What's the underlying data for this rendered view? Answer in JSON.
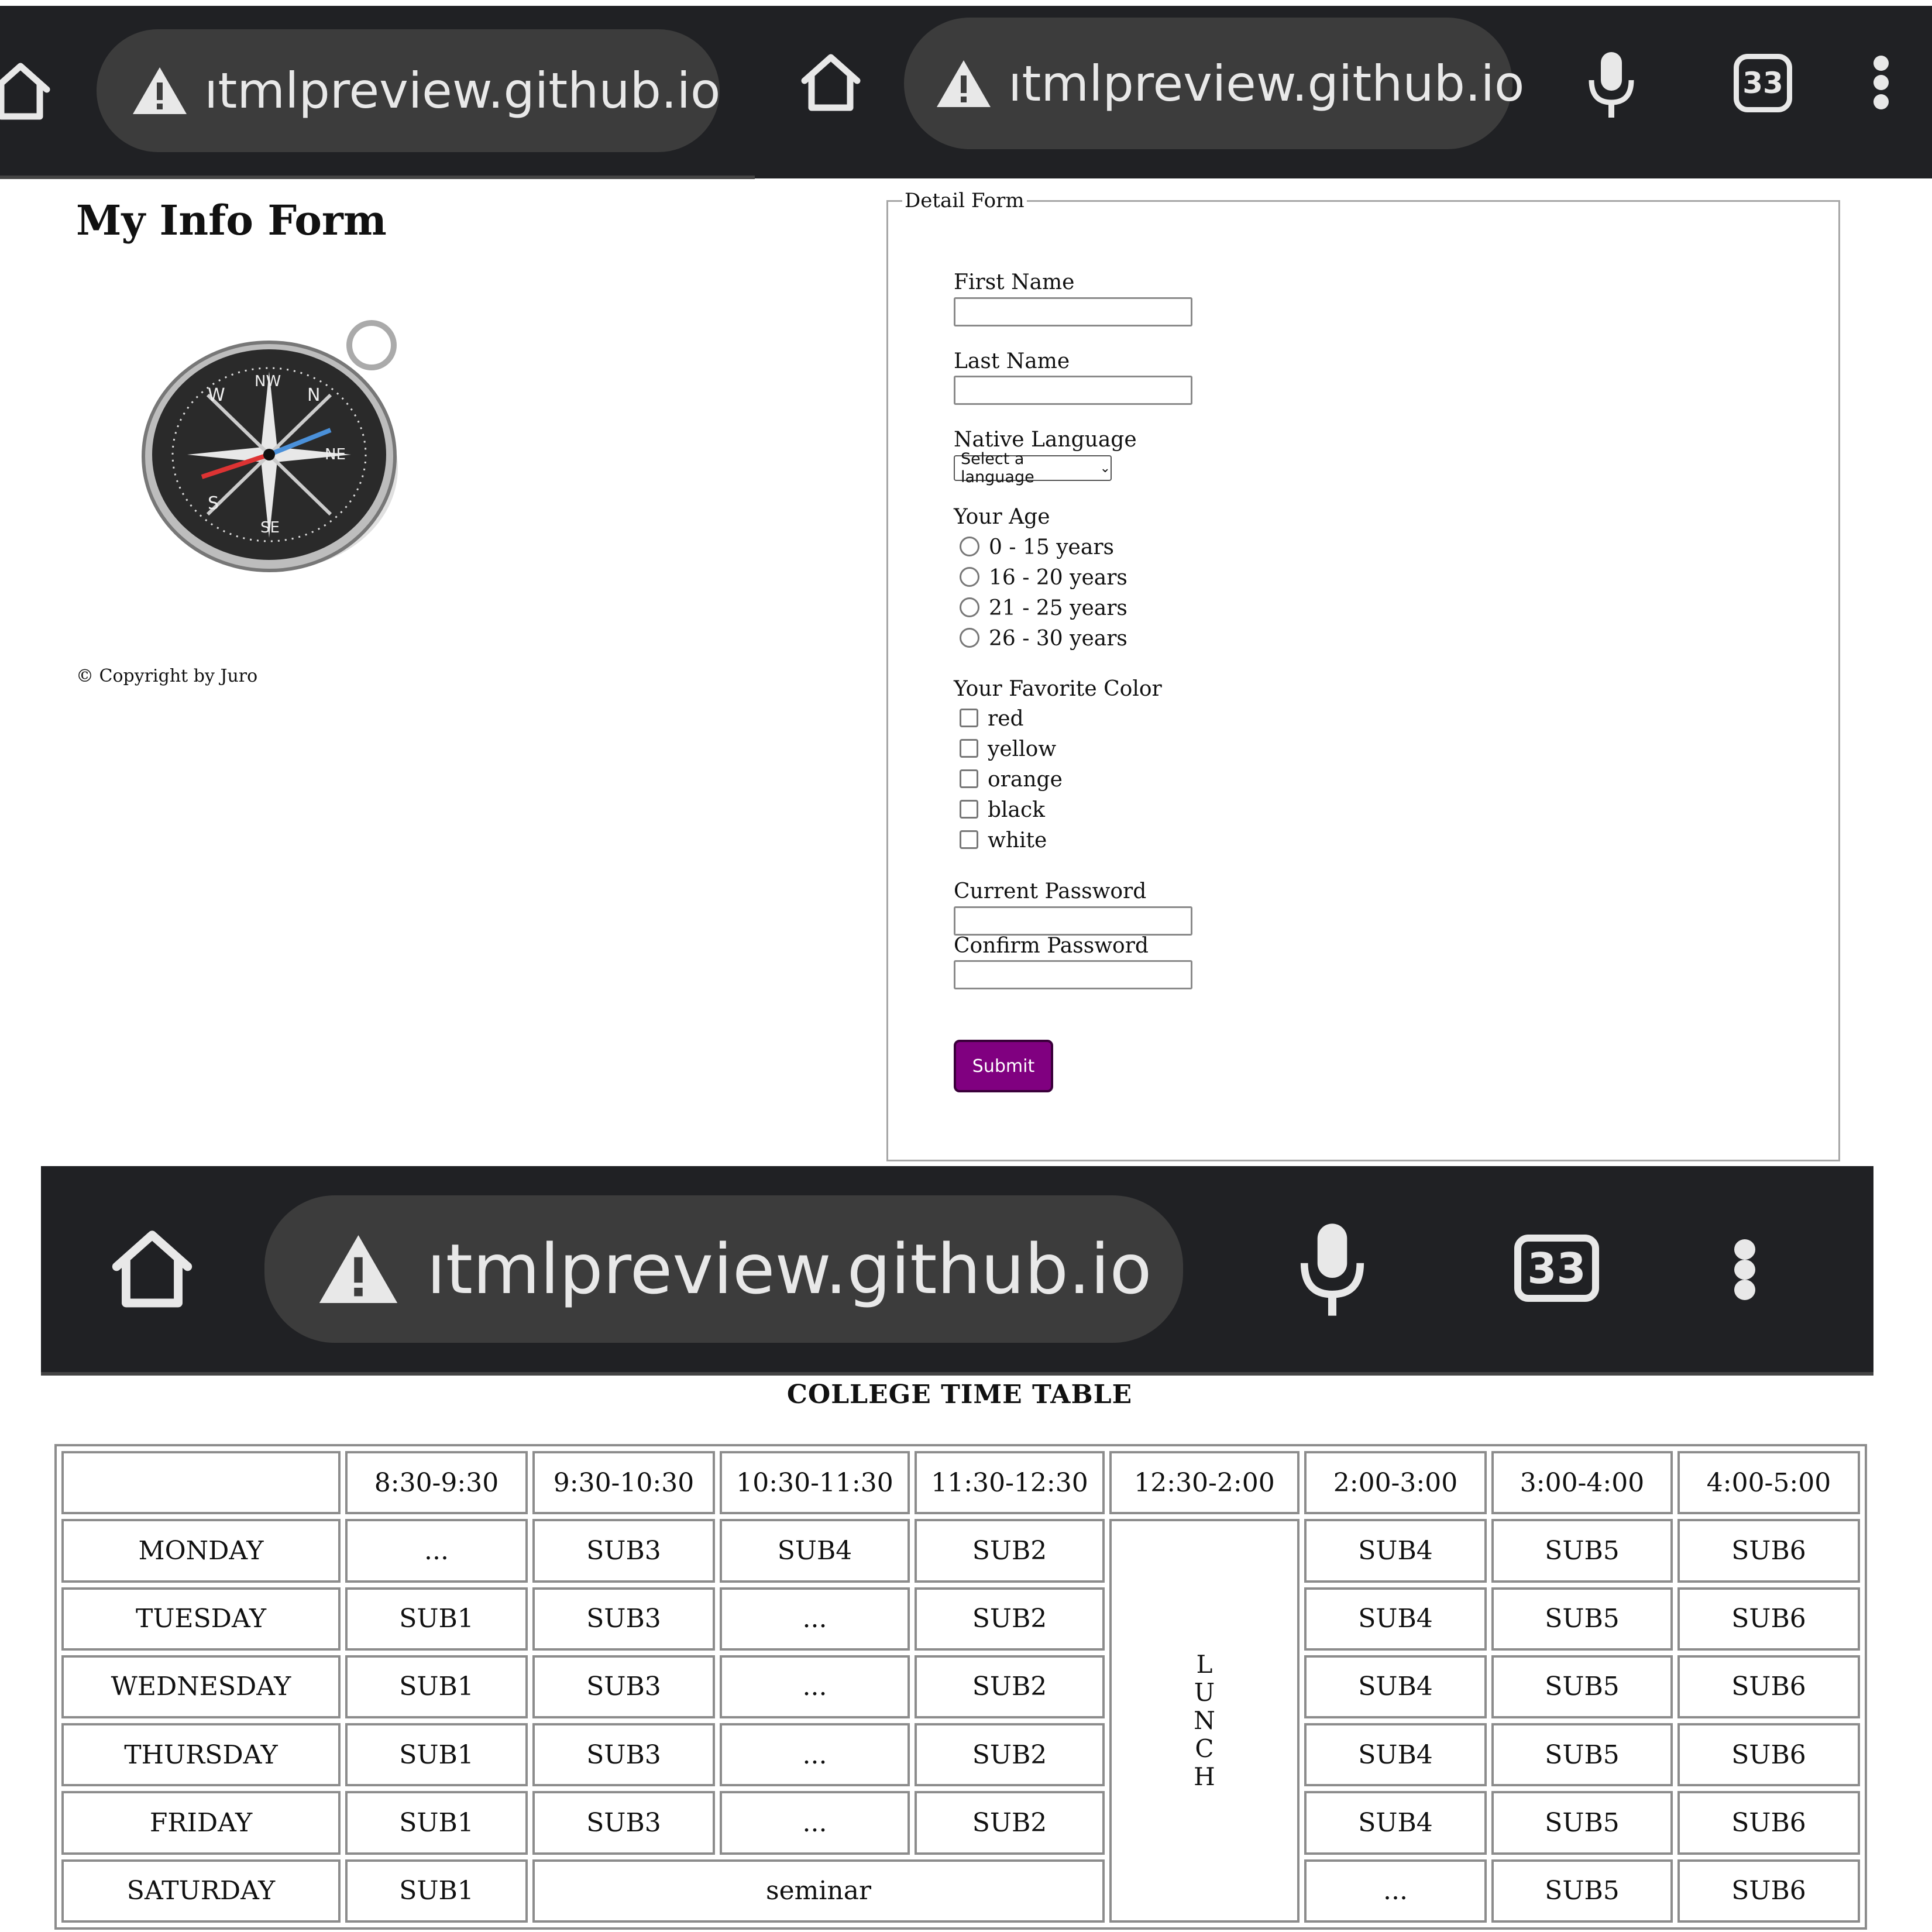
{
  "browser_bar": {
    "url": "ıtmlpreview.github.io",
    "tab_count": "33",
    "home_icon": "home-icon",
    "warning_icon": "warning-icon",
    "mic_icon": "mic-icon",
    "menu_icon": "more-vert-icon",
    "bar_color": "#202124"
  },
  "form_page": {
    "title": "My Info Form",
    "image_icon": "compass-image",
    "copyright": "© Copyright by Juro",
    "legend": "Detail Form",
    "first_name_label": "First Name",
    "last_name_label": "Last Name",
    "native_language_label": "Native Language",
    "language_select_value": "Select a language",
    "age_label": "Your Age",
    "age_options": [
      "0 - 15 years",
      "16 - 20 years",
      "21 - 25 years",
      "26 - 30 years"
    ],
    "color_label": "Your Favorite Color",
    "color_options": [
      "red",
      "yellow",
      "orange",
      "black",
      "white"
    ],
    "current_password_label": "Current Password",
    "confirm_password_label": "Confirm Password",
    "submit_label": "Submit",
    "submit_color": "#800080"
  },
  "timetable": {
    "title": "COLLEGE TIME TABLE",
    "corner": "",
    "time_slots": [
      "8:30-9:30",
      "9:30-10:30",
      "10:30-11:30",
      "11:30-12:30",
      "12:30-2:00",
      "2:00-3:00",
      "3:00-4:00",
      "4:00-5:00"
    ],
    "lunch_letters": [
      "L",
      "U",
      "N",
      "C",
      "H"
    ],
    "rows": [
      {
        "day": "MONDAY",
        "cells": [
          "...",
          "SUB3",
          "SUB4",
          "SUB2",
          "SUB4",
          "SUB5",
          "SUB6"
        ]
      },
      {
        "day": "TUESDAY",
        "cells": [
          "SUB1",
          "SUB3",
          "...",
          "SUB2",
          "SUB4",
          "SUB5",
          "SUB6"
        ]
      },
      {
        "day": "WEDNESDAY",
        "cells": [
          "SUB1",
          "SUB3",
          "...",
          "SUB2",
          "SUB4",
          "SUB5",
          "SUB6"
        ]
      },
      {
        "day": "THURSDAY",
        "cells": [
          "SUB1",
          "SUB3",
          "...",
          "SUB2",
          "SUB4",
          "SUB5",
          "SUB6"
        ]
      },
      {
        "day": "FRIDAY",
        "cells": [
          "SUB1",
          "SUB3",
          "...",
          "SUB2",
          "SUB4",
          "SUB5",
          "SUB6"
        ]
      }
    ],
    "saturday": {
      "day": "SATURDAY",
      "first": "SUB1",
      "seminar": "seminar",
      "after_lunch": [
        "...",
        "SUB5",
        "SUB6"
      ]
    }
  }
}
